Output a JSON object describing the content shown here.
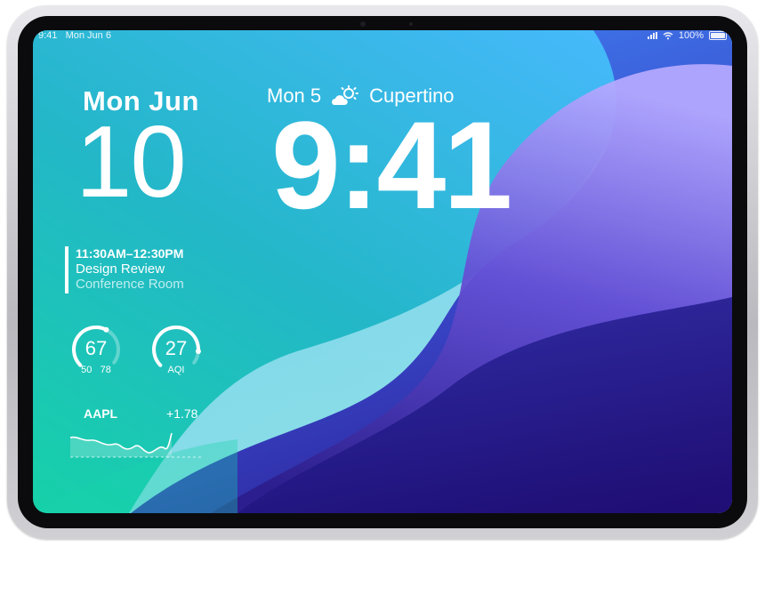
{
  "status_bar": {
    "time": "9:41",
    "date": "Mon Jun 6",
    "battery": "100%"
  },
  "lock_screen": {
    "date_label": "Mon Jun",
    "date_number": "10",
    "weather_date": "Mon 5",
    "weather_city": "Cupertino",
    "time": "9:41"
  },
  "event": {
    "time_range": "11:30AM–12:30PM",
    "title": "Design Review",
    "location": "Conference Room"
  },
  "weather_widget": {
    "temp": "67",
    "low": "50",
    "high": "78",
    "temp_level": 0.6
  },
  "aqi_widget": {
    "value": "27",
    "label": "AQI",
    "level": 0.85
  },
  "stock": {
    "symbol": "AAPL",
    "change": "+1.78"
  },
  "colors": {
    "teal": "#1fc7b5",
    "sky": "#33b6f1",
    "indigo": "#2b1a86",
    "violet": "#5b3fc9"
  }
}
